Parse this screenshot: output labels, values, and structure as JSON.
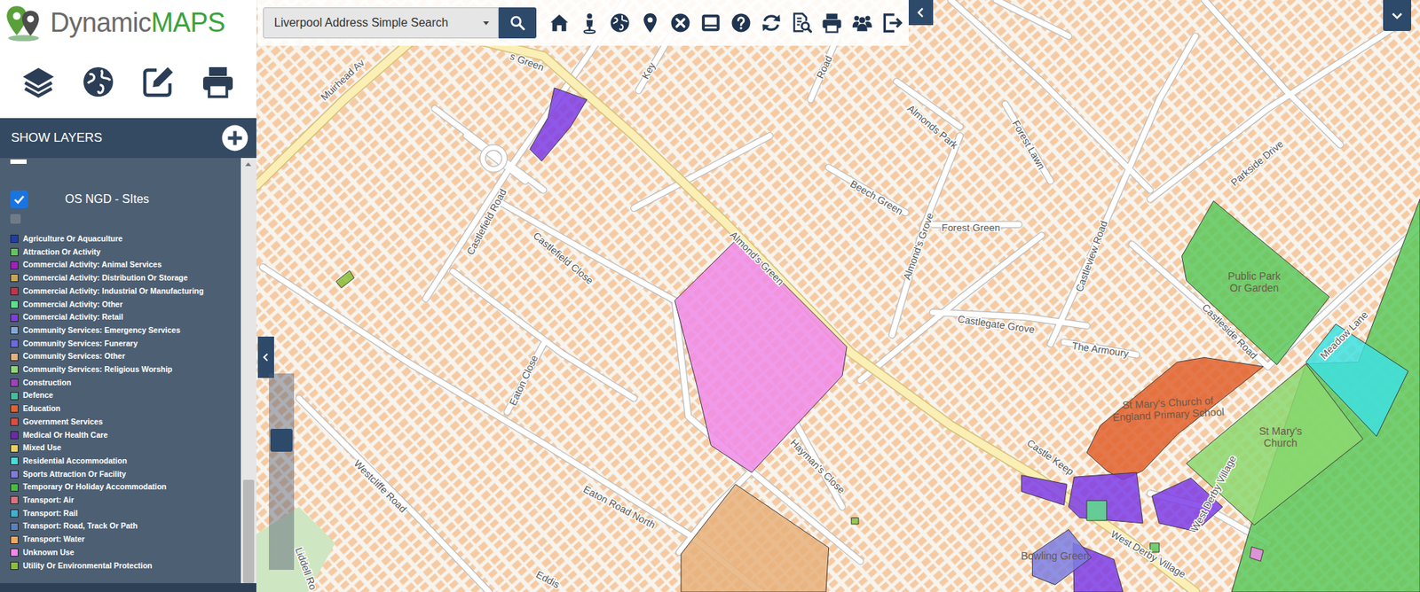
{
  "app": {
    "logo": {
      "first": "Dynamic",
      "second": "MAPS"
    }
  },
  "search": {
    "scope": "Liverpool Address Simple Search"
  },
  "sidebar": {
    "header": "SHOW LAYERS",
    "layer": {
      "label": "OS NGD - SItes",
      "checked": true
    },
    "scrollbar": {
      "level": 1
    },
    "legend": [
      {
        "label": "Agriculture Or Aquaculture",
        "color": "#1f3fa8"
      },
      {
        "label": "Attraction Or Activity",
        "color": "#5cc85c"
      },
      {
        "label": "Commercial Activity: Animal Services",
        "color": "#a020c0"
      },
      {
        "label": "Commercial Activity: Distribution Or Storage",
        "color": "#c8a458"
      },
      {
        "label": "Commercial Activity: Industrial Or Manufacturing",
        "color": "#c8304a"
      },
      {
        "label": "Commercial Activity: Other",
        "color": "#5ee08a"
      },
      {
        "label": "Commercial Activity: Retail",
        "color": "#7d3ce6"
      },
      {
        "label": "Community Services: Emergency Services",
        "color": "#80a8e0"
      },
      {
        "label": "Community Services: Funerary",
        "color": "#6a6ae0"
      },
      {
        "label": "Community Services: Other",
        "color": "#e8b07a"
      },
      {
        "label": "Community Services: Religious Worship",
        "color": "#8cd870"
      },
      {
        "label": "Construction",
        "color": "#a040c0"
      },
      {
        "label": "Defence",
        "color": "#40c0a0"
      },
      {
        "label": "Education",
        "color": "#e2622e"
      },
      {
        "label": "Government Services",
        "color": "#e04a40"
      },
      {
        "label": "Medical Or Health Care",
        "color": "#6a2ab0"
      },
      {
        "label": "Mixed Use",
        "color": "#e8d060"
      },
      {
        "label": "Residential Accommodation",
        "color": "#3ee0e0"
      },
      {
        "label": "Sports Attraction Or Facility",
        "color": "#7c7ce0"
      },
      {
        "label": "Temporary Or Holiday Accommodation",
        "color": "#40c040"
      },
      {
        "label": "Transport: Air",
        "color": "#e07080"
      },
      {
        "label": "Transport: Rail",
        "color": "#40b0d0"
      },
      {
        "label": "Transport: Road, Track Or Path",
        "color": "#5a80c0"
      },
      {
        "label": "Transport: Water",
        "color": "#f0a860"
      },
      {
        "label": "Unknown Use",
        "color": "#f08ae8"
      },
      {
        "label": "Utility Or Environmental Protection",
        "color": "#88c038"
      }
    ]
  },
  "map": {
    "zoom": {
      "level": 0.68
    },
    "labels": [
      {
        "lines": [
          "Muirhead Av"
        ],
        "kind": "street"
      },
      {
        "lines": [
          "s Green"
        ],
        "kind": "street"
      },
      {
        "lines": [
          "Key"
        ],
        "kind": "street"
      },
      {
        "lines": [
          "Road"
        ],
        "kind": "street"
      },
      {
        "lines": [
          "Castlefield Road"
        ],
        "kind": "street"
      },
      {
        "lines": [
          "Castlefield Close"
        ],
        "kind": "street"
      },
      {
        "lines": [
          "Almond's Green"
        ],
        "kind": "street"
      },
      {
        "lines": [
          "Almonds Park"
        ],
        "kind": "street"
      },
      {
        "lines": [
          "Forest Lawn"
        ],
        "kind": "street"
      },
      {
        "lines": [
          "Beech Green"
        ],
        "kind": "street"
      },
      {
        "lines": [
          "Almond's Grove"
        ],
        "kind": "street"
      },
      {
        "lines": [
          "Forest Green"
        ],
        "kind": "street"
      },
      {
        "lines": [
          "Castleview Road"
        ],
        "kind": "street"
      },
      {
        "lines": [
          "Parkside Drive"
        ],
        "kind": "street"
      },
      {
        "lines": [
          "Castlegate Grove"
        ],
        "kind": "street"
      },
      {
        "lines": [
          "The Armoury"
        ],
        "kind": "street"
      },
      {
        "lines": [
          "Castleside Road"
        ],
        "kind": "street"
      },
      {
        "lines": [
          "Meadow Lane"
        ],
        "kind": "street"
      },
      {
        "lines": [
          "Public Park",
          "Or Garden"
        ],
        "kind": "site"
      },
      {
        "lines": [
          "St Mary's Church of",
          "England Primary School"
        ],
        "kind": "site"
      },
      {
        "lines": [
          "St Mary's",
          "Church"
        ],
        "kind": "site"
      },
      {
        "lines": [
          "Castle Keep"
        ],
        "kind": "street"
      },
      {
        "lines": [
          "West Derby Village"
        ],
        "kind": "street"
      },
      {
        "lines": [
          "West Derby Village"
        ],
        "kind": "street"
      },
      {
        "lines": [
          "Bowling Green"
        ],
        "kind": "site"
      },
      {
        "lines": [
          "Hayman's Close"
        ],
        "kind": "street"
      },
      {
        "lines": [
          "Eaton Road North"
        ],
        "kind": "street"
      },
      {
        "lines": [
          "Eaton Close"
        ],
        "kind": "street"
      },
      {
        "lines": [
          "Westcliffe Road"
        ],
        "kind": "street"
      },
      {
        "lines": [
          "Liddell Ro"
        ],
        "kind": "street"
      },
      {
        "lines": [
          "Eddis"
        ],
        "kind": "street"
      }
    ]
  }
}
